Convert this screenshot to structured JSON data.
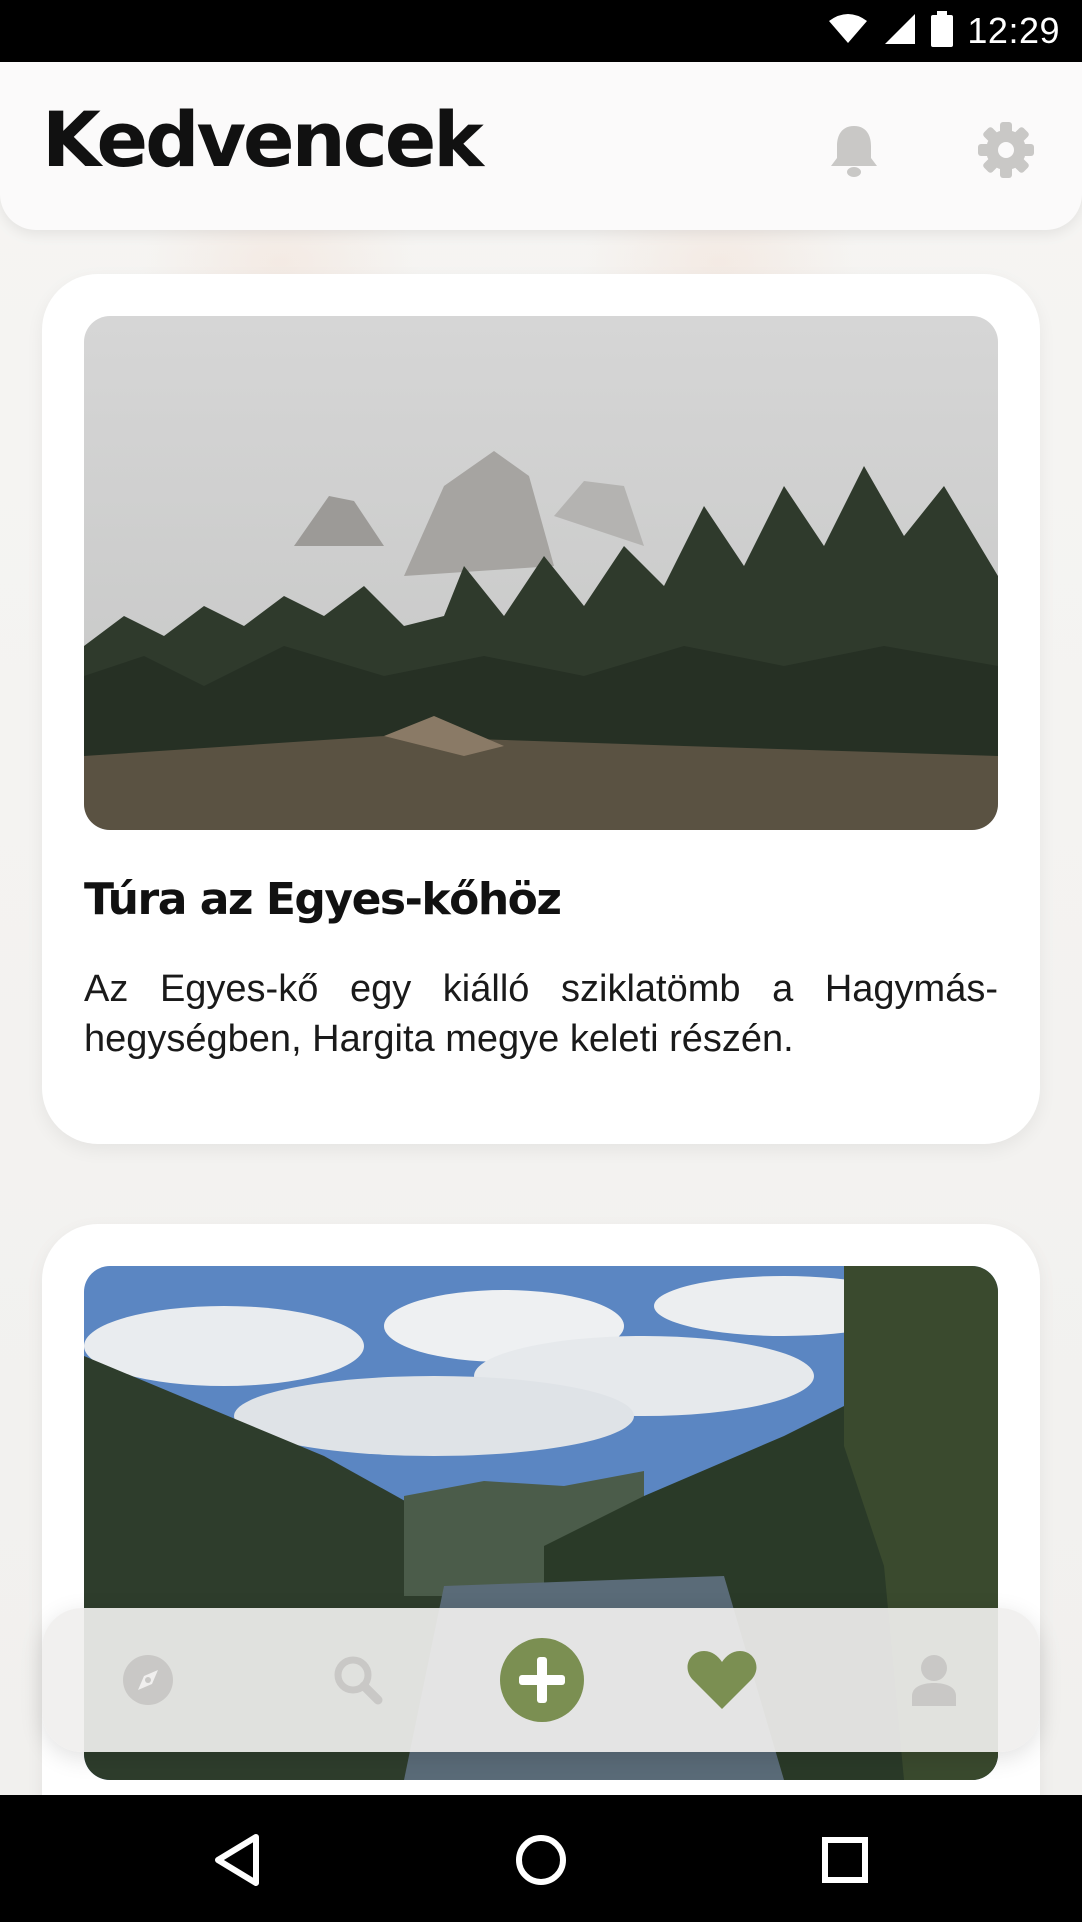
{
  "status_bar": {
    "time": "12:29",
    "icons": [
      "wifi-icon",
      "signal-icon",
      "battery-icon"
    ]
  },
  "header": {
    "title": "Kedvencek",
    "icons": [
      "bell-icon",
      "gear-icon"
    ]
  },
  "cards": [
    {
      "title": "Túra az Egyes-kőhöz",
      "description": "Az Egyes-kő egy kiálló sziklatömb a Hagymás-hegységben, Hargita megye keleti részén.",
      "image": "mountain-rocks-forest-photo"
    },
    {
      "title": "",
      "description": "",
      "image": "lake-valley-forest-photo"
    }
  ],
  "bottom_nav": {
    "items": [
      "explore-icon",
      "search-icon",
      "add-icon",
      "favorites-icon",
      "profile-icon"
    ],
    "active": "favorites",
    "accent_color": "#7b8f52",
    "inactive_color": "#c9c8c6"
  },
  "system_nav": [
    "back-icon",
    "home-icon",
    "recents-icon"
  ]
}
